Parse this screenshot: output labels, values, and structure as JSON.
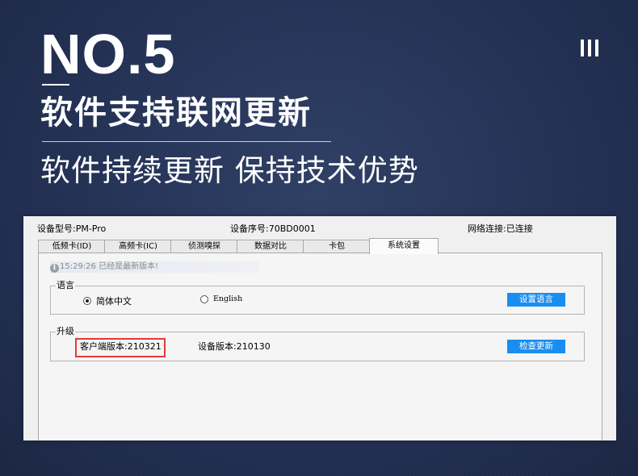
{
  "banner": {
    "number": "NO.5",
    "roman_icon": "roman-numeral-three-icon",
    "headline": "软件支持联网更新",
    "subline": "软件持续更新 保持技术优势"
  },
  "app": {
    "info": {
      "model": "设备型号:PM-Pro",
      "serial": "设备序号:70BD0001",
      "network": "网络连接:已连接"
    },
    "tabs": [
      {
        "label": "低频卡(ID)",
        "active": false
      },
      {
        "label": "高频卡(IC)",
        "active": false
      },
      {
        "label": "侦测嗅探",
        "active": false
      },
      {
        "label": "数据对比",
        "active": false
      },
      {
        "label": "卡包",
        "active": false
      },
      {
        "label": "系统设置",
        "active": true
      }
    ],
    "status": {
      "icon": "info-icon",
      "icon_glyph": "i",
      "text": "15:29:26 已经是最新版本!"
    },
    "language": {
      "title": "语言",
      "options": [
        {
          "label": "简体中文",
          "selected": true
        },
        {
          "label": "English",
          "selected": false
        }
      ],
      "button": "设置语言"
    },
    "upgrade": {
      "title": "升级",
      "client_version": "客户端版本:210321",
      "device_version": "设备版本:210130",
      "button": "检查更新"
    },
    "colors": {
      "accent_button": "#1a8ef0",
      "highlight_border": "#e53935",
      "background": "#233155"
    }
  }
}
